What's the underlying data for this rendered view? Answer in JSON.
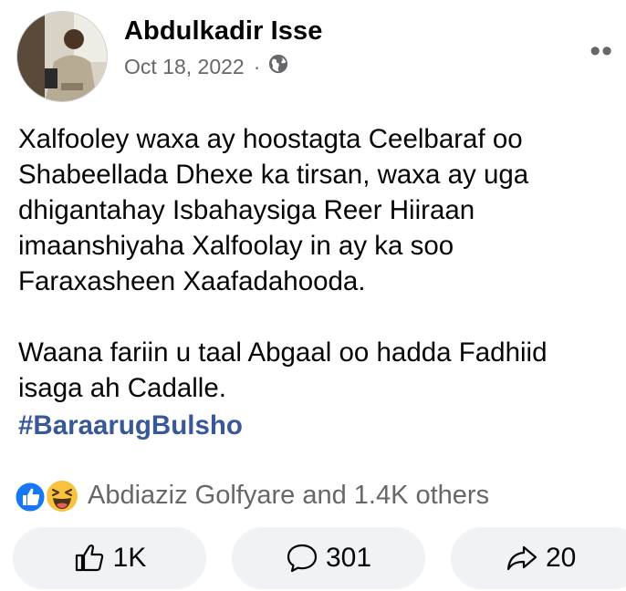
{
  "post": {
    "author": "Abdulkadir Isse",
    "date": "Oct 18, 2022",
    "separator": "·",
    "audience_icon": "globe-icon",
    "menu_icon": "more-options-icon",
    "text_paragraph_1": "Xalfooley waxa ay hoostagta Ceelbaraf oo Shabeellada Dhexe ka tirsan, waxa ay uga dhigantahay Isbahaysiga Reer Hiiraan imaanshiyaha Xalfoolay in ay ka soo Faraxasheen Xaafadahooda.",
    "text_paragraph_2": "Waana fariin u taal Abgaal oo hadda Fadhiid isaga ah Cadalle.",
    "hashtag": "#BaraarugBulsho"
  },
  "reactions": {
    "icons": [
      "like-reaction-icon",
      "haha-reaction-icon"
    ],
    "summary": "Abdiaziz Golfyare and 1.4K others"
  },
  "actions": {
    "like_count": "1K",
    "comment_count": "301",
    "share_count": "20"
  },
  "colors": {
    "link": "#385898",
    "secondary_text": "#65676b",
    "button_bg": "#f0f2f5",
    "like_blue": "#1877f2",
    "haha_yellow": "#f7c23f"
  }
}
